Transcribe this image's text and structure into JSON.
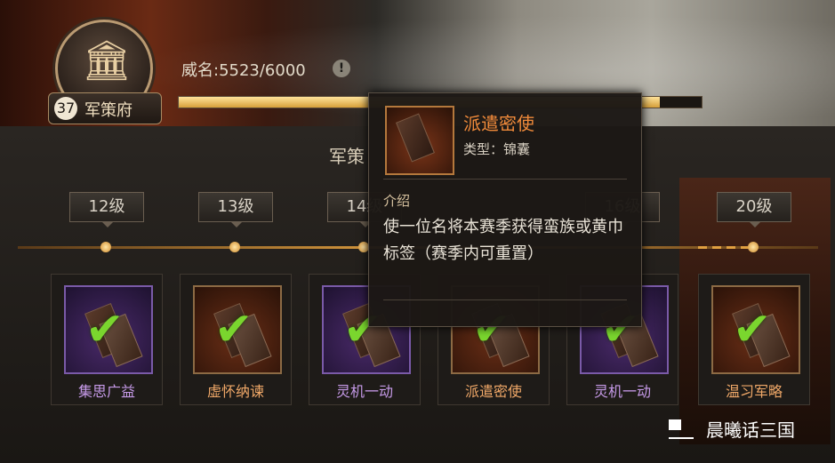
{
  "header": {
    "building_level": "37",
    "building_name": "军策府",
    "prestige_label": "威名:5523/6000",
    "prestige_current": 5523,
    "prestige_max": 6000,
    "progress_fraction": 0.92
  },
  "section_title": "军策",
  "level_tags": [
    "12级",
    "13级",
    "14级",
    "16级",
    "20级"
  ],
  "cards": [
    {
      "name": "集思广益",
      "color": "#c69ae8",
      "frame": "purple"
    },
    {
      "name": "虚怀纳谏",
      "color": "#f0a868",
      "frame": "orange"
    },
    {
      "name": "灵机一动",
      "color": "#c69ae8",
      "frame": "purple"
    },
    {
      "name": "派遣密使",
      "color": "#f0a868",
      "frame": "orange"
    },
    {
      "name": "灵机一动",
      "color": "#c69ae8",
      "frame": "purple"
    },
    {
      "name": "温习军略",
      "color": "#f0a868",
      "frame": "orange"
    }
  ],
  "tooltip": {
    "title": "派遣密使",
    "type_label": "类型：锦囊",
    "section_label": "介绍",
    "description": "使一位名将本赛季获得蛮族或黄巾标签（赛季内可重置）"
  },
  "watermark": "晨曦话三国",
  "icons": {
    "building": "palace-icon",
    "info": "info-icon",
    "check": "checkmark-icon"
  }
}
